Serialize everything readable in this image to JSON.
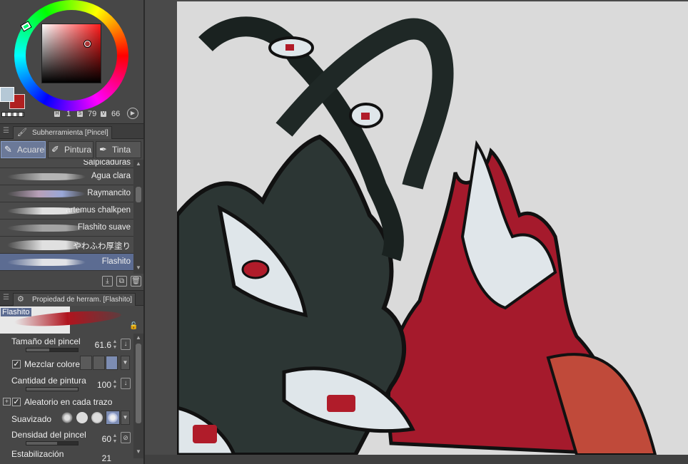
{
  "color": {
    "main_color": "#b5c8d6",
    "sub_color": "#b02020",
    "hsv": {
      "h": "1",
      "s": "79",
      "v": "66"
    }
  },
  "subtool_panel": {
    "tab_label": "Subherramienta [Pincel]",
    "groups": [
      {
        "label": "Acuarela",
        "icon": "brush-icon",
        "active": true
      },
      {
        "label": "Pintura",
        "icon": "paint-icon",
        "active": false
      },
      {
        "label": "Tinta",
        "icon": "pen-icon",
        "active": false
      }
    ],
    "brushes": [
      {
        "label": "Salpicaduras",
        "selected": false
      },
      {
        "label": "Agua clara",
        "selected": false
      },
      {
        "label": "Raymancito",
        "selected": false
      },
      {
        "label": "artemus chalkpen",
        "selected": false
      },
      {
        "label": "Flashito suave",
        "selected": false
      },
      {
        "label": "やわふわ厚塗り",
        "selected": false
      },
      {
        "label": "Flashito",
        "selected": true
      }
    ]
  },
  "tool_property": {
    "tab_label": "Propiedad de herram. [Flashito]",
    "preview_name": "Flashito",
    "brush_size": {
      "label": "Tamaño del pincel",
      "value": "61.6",
      "fraction": 0.45
    },
    "mix_colors": {
      "label": "Mezclar colores",
      "checked": true
    },
    "paint_amount": {
      "label": "Cantidad de pintura",
      "value": "100",
      "fraction": 1.0
    },
    "random_stroke": {
      "label": "Aleatorio en cada trazo",
      "checked": true
    },
    "smoothing": {
      "label": "Suavizado"
    },
    "brush_density": {
      "label": "Densidad del pincel",
      "value": "60",
      "fraction": 0.6
    },
    "stabilization": {
      "label": "Estabilización",
      "value": "21"
    }
  }
}
